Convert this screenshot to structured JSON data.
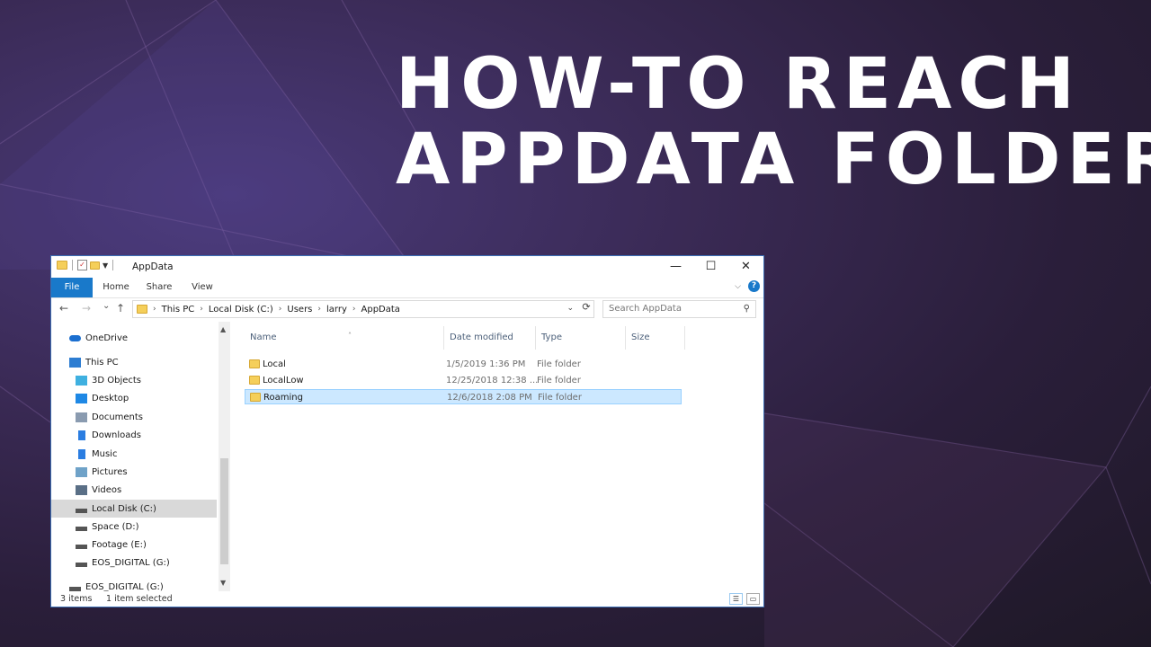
{
  "headline": {
    "line1": "HOW-TO REACH",
    "line2": "APPDATA FOLDER"
  },
  "window": {
    "title": "AppData",
    "controls": {
      "minimize": "—",
      "maximize": "☐",
      "close": "✕"
    }
  },
  "ribbon": {
    "tabs": [
      "File",
      "Home",
      "Share",
      "View"
    ]
  },
  "nav": {
    "back": "←",
    "forward": "→",
    "recent": "⌄",
    "up": "↑",
    "breadcrumb": [
      "This PC",
      "Local Disk (C:)",
      "Users",
      "larry",
      "AppData"
    ],
    "search_placeholder": "Search AppData"
  },
  "sidebar": {
    "items": [
      {
        "label": "OneDrive",
        "icon": "cloud-icon",
        "color": "#1b6fd0"
      },
      {
        "label": "This PC",
        "icon": "computer-icon",
        "color": "#2d7dd2"
      },
      {
        "label": "3D Objects",
        "icon": "cube-icon",
        "color": "#3fb0e0"
      },
      {
        "label": "Desktop",
        "icon": "desktop-icon",
        "color": "#1e88e5"
      },
      {
        "label": "Documents",
        "icon": "document-icon",
        "color": "#8a9bb0"
      },
      {
        "label": "Downloads",
        "icon": "download-arrow-icon",
        "color": "#2a7de1"
      },
      {
        "label": "Music",
        "icon": "music-note-icon",
        "color": "#2a7de1"
      },
      {
        "label": "Pictures",
        "icon": "picture-icon",
        "color": "#6fa2c8"
      },
      {
        "label": "Videos",
        "icon": "film-icon",
        "color": "#5a6f86"
      },
      {
        "label": "Local Disk (C:)",
        "icon": "drive-icon",
        "color": "#555555",
        "selected": true
      },
      {
        "label": "Space (D:)",
        "icon": "drive-icon",
        "color": "#555555"
      },
      {
        "label": "Footage (E:)",
        "icon": "drive-icon",
        "color": "#555555"
      },
      {
        "label": "EOS_DIGITAL (G:)",
        "icon": "drive-icon",
        "color": "#555555"
      },
      {
        "label": "EOS_DIGITAL (G:)",
        "icon": "drive-icon",
        "color": "#555555"
      }
    ]
  },
  "table": {
    "columns": [
      "Name",
      "Date modified",
      "Type",
      "Size"
    ],
    "rows": [
      {
        "name": "Local",
        "date": "1/5/2019 1:36 PM",
        "type": "File folder"
      },
      {
        "name": "LocalLow",
        "date": "12/25/2018 12:38 ...",
        "type": "File folder"
      },
      {
        "name": "Roaming",
        "date": "12/6/2018 2:08 PM",
        "type": "File folder",
        "selected": true
      }
    ]
  },
  "status": {
    "count": "3 items",
    "selection": "1 item selected"
  },
  "colors": {
    "accent": "#1979ca",
    "selection": "#cce8ff",
    "folder": "#f5cf5a"
  }
}
